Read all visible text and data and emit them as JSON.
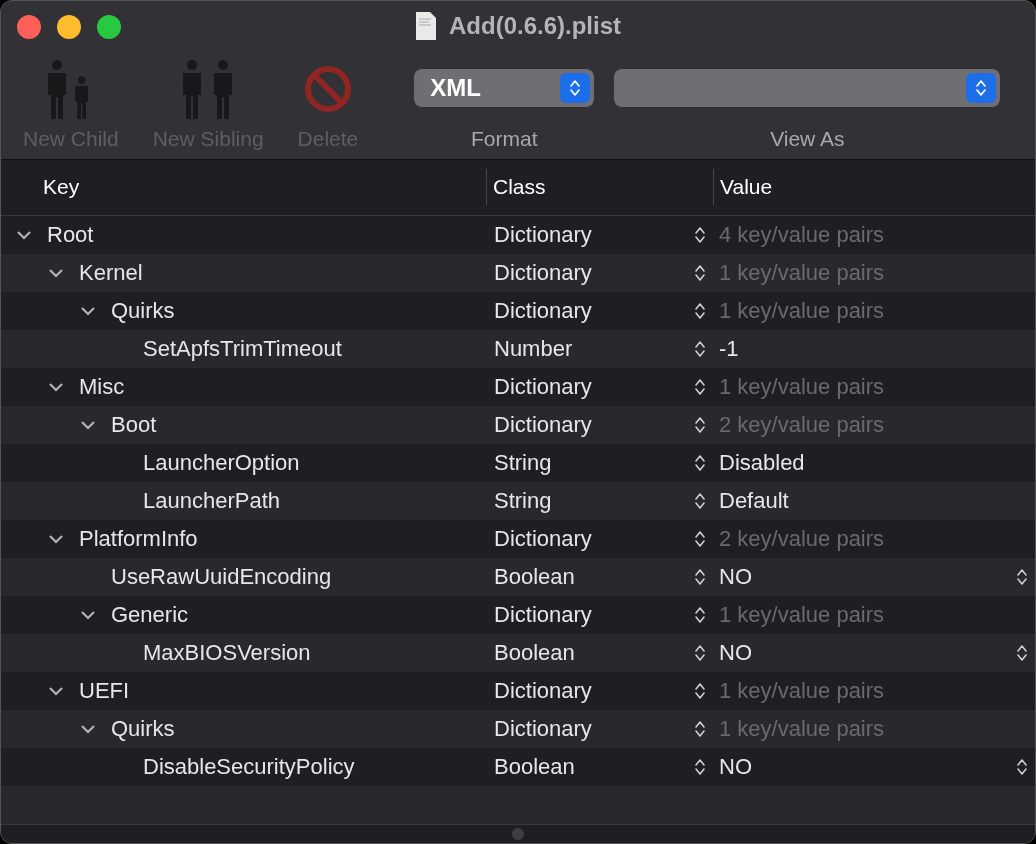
{
  "window": {
    "title": "Add(0.6.6).plist"
  },
  "toolbar": {
    "buttons": [
      {
        "label": "New Child",
        "kind": "child",
        "disabled": true
      },
      {
        "label": "New Sibling",
        "kind": "sibling",
        "disabled": true
      },
      {
        "label": "Delete",
        "kind": "delete",
        "disabled": true
      }
    ],
    "format": {
      "label": "Format",
      "value": "XML"
    },
    "view_as": {
      "label": "View As"
    }
  },
  "table": {
    "columns": [
      "Key",
      "Class",
      "Value"
    ],
    "rows": [
      {
        "key": "Root",
        "class": "Dictionary",
        "value": "4 key/value pairs",
        "kind": "summary",
        "expanded": true,
        "children": [
          {
            "key": "Kernel",
            "class": "Dictionary",
            "value": "1 key/value pairs",
            "kind": "summary",
            "expanded": true,
            "children": [
              {
                "key": "Quirks",
                "class": "Dictionary",
                "value": "1 key/value pairs",
                "kind": "summary",
                "expanded": true,
                "children": [
                  {
                    "key": "SetApfsTrimTimeout",
                    "class": "Number",
                    "value": "-1",
                    "kind": "text"
                  }
                ]
              }
            ]
          },
          {
            "key": "Misc",
            "class": "Dictionary",
            "value": "1 key/value pairs",
            "kind": "summary",
            "expanded": true,
            "children": [
              {
                "key": "Boot",
                "class": "Dictionary",
                "value": "2 key/value pairs",
                "kind": "summary",
                "expanded": true,
                "children": [
                  {
                    "key": "LauncherOption",
                    "class": "String",
                    "value": "Disabled",
                    "kind": "text"
                  },
                  {
                    "key": "LauncherPath",
                    "class": "String",
                    "value": "Default",
                    "kind": "text"
                  }
                ]
              }
            ]
          },
          {
            "key": "PlatformInfo",
            "class": "Dictionary",
            "value": "2 key/value pairs",
            "kind": "summary",
            "expanded": true,
            "children": [
              {
                "key": "UseRawUuidEncoding",
                "class": "Boolean",
                "value": "NO",
                "kind": "popup"
              },
              {
                "key": "Generic",
                "class": "Dictionary",
                "value": "1 key/value pairs",
                "kind": "summary",
                "expanded": true,
                "children": [
                  {
                    "key": "MaxBIOSVersion",
                    "class": "Boolean",
                    "value": "NO",
                    "kind": "popup"
                  }
                ]
              }
            ]
          },
          {
            "key": "UEFI",
            "class": "Dictionary",
            "value": "1 key/value pairs",
            "kind": "summary",
            "expanded": true,
            "children": [
              {
                "key": "Quirks",
                "class": "Dictionary",
                "value": "1 key/value pairs",
                "kind": "summary",
                "expanded": true,
                "children": [
                  {
                    "key": "DisableSecurityPolicy",
                    "class": "Boolean",
                    "value": "NO",
                    "kind": "popup"
                  }
                ]
              }
            ]
          }
        ]
      }
    ]
  }
}
